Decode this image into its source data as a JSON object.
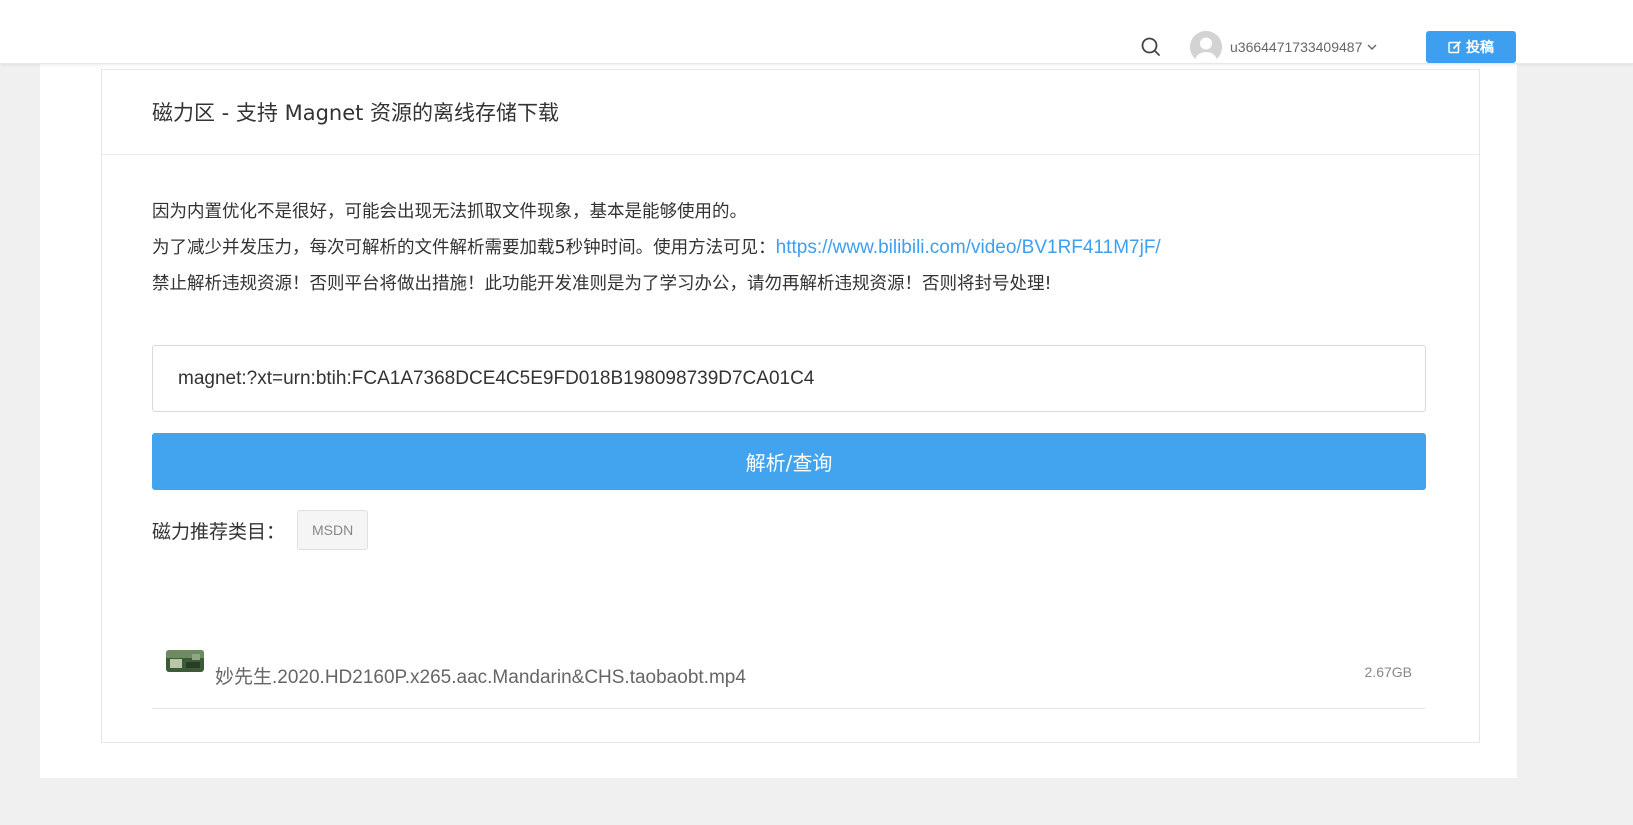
{
  "header": {
    "username": "u3664471733409487",
    "post_label": "投稿"
  },
  "card": {
    "title": "磁力区 - 支持 Magnet 资源的离线存储下载"
  },
  "notice": {
    "line1": "因为内置优化不是很好，可能会出现无法抓取文件现象，基本是能够使用的。",
    "line2_text": "为了减少并发压力，每次可解析的文件解析需要加载5秒钟时间。使用方法可见：",
    "line2_link": "https://www.bilibili.com/video/BV1RF411M7jF/",
    "line3": "禁止解析违规资源！否则平台将做出措施！此功能开发准则是为了学习办公，请勿再解析违规资源！否则将封号处理!"
  },
  "search": {
    "value": "magnet:?xt=urn:btih:FCA1A7368DCE4C5E9FD018B198098739D7CA01C4"
  },
  "parse_button": {
    "label": "解析/查询"
  },
  "categories": {
    "label": "磁力推荐类目：",
    "items": [
      "MSDN"
    ]
  },
  "results": [
    {
      "name": "妙先生.2020.HD2160P.x265.aac.Mandarin&CHS.taobaobt.mp4",
      "size": "2.67GB"
    }
  ],
  "colors": {
    "accent": "#42a3ee",
    "link": "#3e9ff0",
    "page_bg": "#f0f0f0"
  },
  "icons": {
    "search": "search-icon",
    "avatar": "user-avatar-icon",
    "dropdown": "chevron-down-icon",
    "post": "edit-icon"
  }
}
